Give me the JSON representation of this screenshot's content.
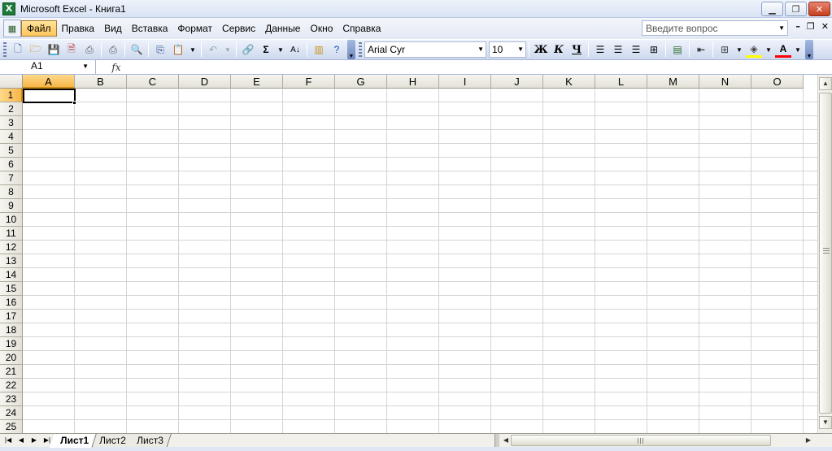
{
  "window": {
    "title": "Microsoft Excel - Книга1",
    "app_icon": "excel-icon",
    "controls": [
      "minimize",
      "restore",
      "close"
    ]
  },
  "menu": {
    "items": [
      {
        "label": "Файл",
        "active": true
      },
      {
        "label": "Правка"
      },
      {
        "label": "Вид"
      },
      {
        "label": "Вставка"
      },
      {
        "label": "Формат"
      },
      {
        "label": "Сервис"
      },
      {
        "label": "Данные"
      },
      {
        "label": "Окно"
      },
      {
        "label": "Справка"
      }
    ],
    "help_placeholder": "Введите вопрос"
  },
  "toolbar": {
    "font_name": "Arial Cyr",
    "font_size": "10",
    "bold_label": "Ж",
    "italic_label": "К",
    "underline_label": "Ч",
    "sum_label": "Σ",
    "colors": {
      "highlight": "#ffff00",
      "font": "#ff0000"
    }
  },
  "formula_bar": {
    "name_box": "A1",
    "fx_label": "fx",
    "value": ""
  },
  "grid": {
    "columns": [
      "A",
      "B",
      "C",
      "D",
      "E",
      "F",
      "G",
      "H",
      "I",
      "J",
      "K",
      "L",
      "M",
      "N",
      "O"
    ],
    "rows": [
      "1",
      "2",
      "3",
      "4",
      "5",
      "6",
      "7",
      "8",
      "9",
      "10",
      "11",
      "12",
      "13",
      "14",
      "15",
      "16",
      "17",
      "18",
      "19",
      "20",
      "21",
      "22",
      "23",
      "24",
      "25"
    ],
    "selected_cell": "A1"
  },
  "sheets": {
    "tabs": [
      "Лист1",
      "Лист2",
      "Лист3"
    ],
    "active": "Лист1"
  }
}
